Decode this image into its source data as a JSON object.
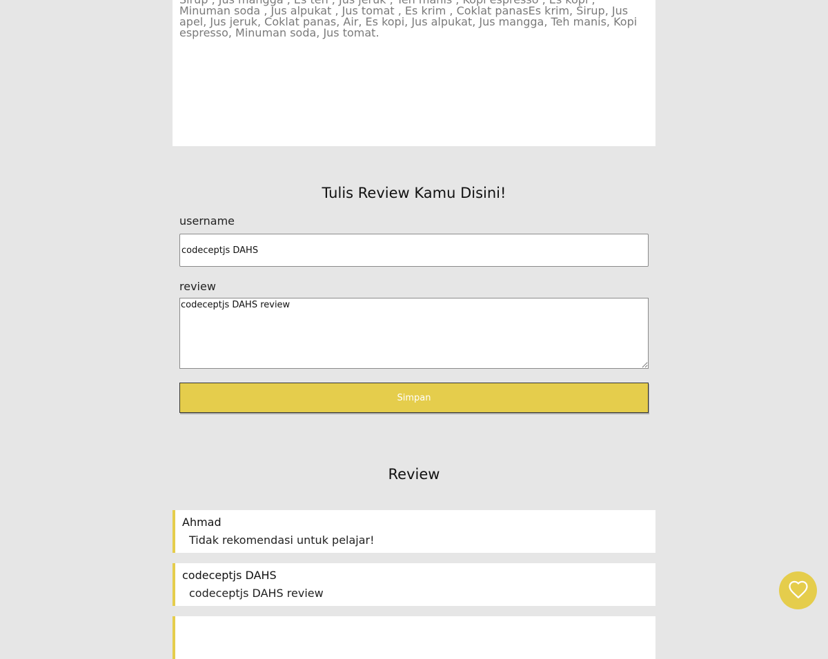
{
  "menu": {
    "description": "Sirup , Jus mangga , Es teh , Jus jeruk , Teh manis , Kopi espresso , Es kopi , Minuman soda , Jus alpukat , Jus tomat , Es krim , Coklat panasEs krim, Sirup, Jus apel, Jus jeruk, Coklat panas, Air, Es kopi, Jus alpukat, Jus mangga, Teh manis, Kopi espresso, Minuman soda, Jus tomat."
  },
  "review_form": {
    "title": "Tulis Review Kamu Disini!",
    "username_label": "username",
    "username_value": "codeceptjs DAHS",
    "review_label": "review",
    "review_value": "codeceptjs DAHS review",
    "submit_label": "Simpan"
  },
  "reviews_section": {
    "title": "Review",
    "items": [
      {
        "name": "Ahmad",
        "review": "Tidak rekomendasi untuk pelajar!"
      },
      {
        "name": "codeceptjs DAHS",
        "review": "codeceptjs DAHS review"
      },
      {
        "name": "",
        "review": ""
      }
    ]
  },
  "colors": {
    "accent": "#e5cd4c",
    "background": "#e6e6e6",
    "card": "#ffffff"
  },
  "icons": {
    "favorite": "heart-outline-icon"
  }
}
